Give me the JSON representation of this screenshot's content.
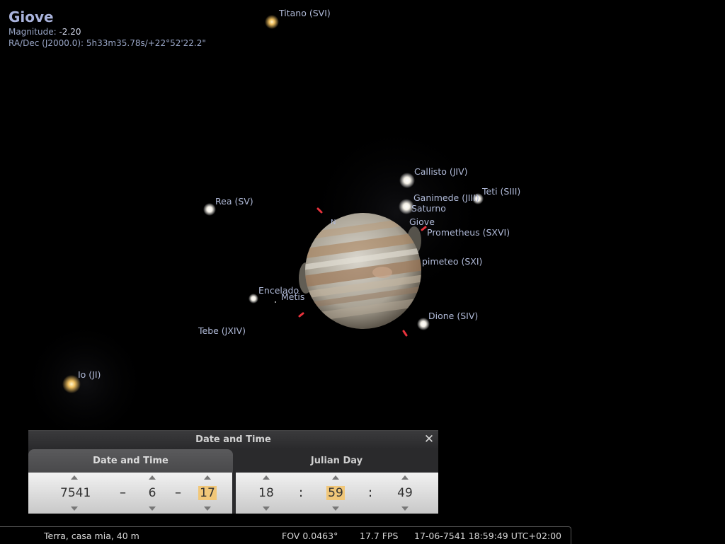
{
  "object_info": {
    "name": "Giove",
    "magnitude_label": "Magnitude:",
    "magnitude_value": "-2.20",
    "radec_label": "RA/Dec (J2000.0):",
    "radec_value": "5h33m35.78s/+22°52'22.2\""
  },
  "sky_labels": {
    "titano": "Titano (SVI)",
    "callisto": "Callisto (JIV)",
    "teti": "Teti (SIII)",
    "ganimede": "Ganimede (JIII)",
    "saturno": "Saturno",
    "giove": "Giove",
    "prometheus": "Prometheus (SXVI)",
    "epimeteo": "pimeteo (SXI)",
    "rea": "Rea (SV)",
    "encelado": "Encelado",
    "metis": "Metis",
    "dione": "Dione (SIV)",
    "tebe": "Tebe (JXIV)",
    "io": "Io (JI)",
    "n_label": "N"
  },
  "dialog": {
    "title": "Date and Time",
    "close_symbol": "✕",
    "tabs": [
      "Date and Time",
      "Julian Day"
    ],
    "date": {
      "year": "7541",
      "month": "6",
      "day": "17",
      "sep": "–"
    },
    "time": {
      "hour": "18",
      "minute": "59",
      "second": "49",
      "sep": ":"
    }
  },
  "status_bar": {
    "location": "Terra, casa mia, 40 m",
    "fov": "FOV 0.0463°",
    "fps": "17.7 FPS",
    "datetime": "17-06-7541 18:59:49 UTC+02:00"
  },
  "colors": {
    "label": "#b0bad8",
    "highlight": "#f1c779",
    "marker": "#e8323c"
  }
}
